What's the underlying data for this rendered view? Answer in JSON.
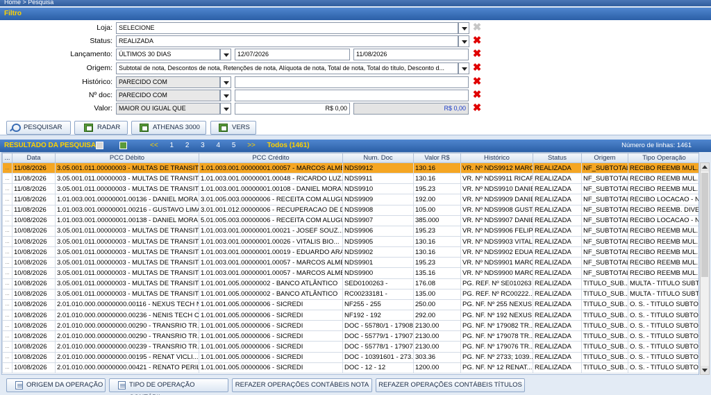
{
  "breadcrumb": "Home > Pesquisa",
  "filter": {
    "title": "Filtro",
    "loja_label": "Loja:",
    "loja_value": "SELECIONE",
    "status_label": "Status:",
    "status_value": "REALIZADA",
    "lancamento_label": "Lançamento:",
    "lancamento_value": "ÚLTIMOS 30 DIAS",
    "lancamento_from": "12/07/2026",
    "lancamento_to": "11/08/2026",
    "origem_label": "Origem:",
    "origem_value": "Subtotal de nota, Descontos de nota, Retenções de nota, Alíquota de nota, Total de nota, Total do título, Desconto d...",
    "historico_label": "Histórico:",
    "historico_value": "PARECIDO COM",
    "historico_text": "",
    "ndoc_label": "Nº doc:",
    "ndoc_value": "PARECIDO COM",
    "ndoc_text": "",
    "valor_label": "Valor:",
    "valor_value": "MAIOR  OU IGUAL QUE",
    "valor_from": "R$ 0,00",
    "valor_to": "R$ 0,00"
  },
  "toolbar": {
    "pesquisar": "PESQUISAR",
    "radar": "RADAR",
    "athenas": "ATHENAS 3000",
    "vers": "VERS"
  },
  "results": {
    "title": "RESULTADO DA PESQUISA",
    "prev": "<<",
    "pages": [
      "1",
      "2",
      "3",
      "4",
      "5"
    ],
    "next": ">>",
    "todos": "Todos (1461)",
    "line_count": "Número de linhas: 1461",
    "columns": [
      "...",
      "Data",
      "PCC Débito",
      "PCC Crédito",
      "Num. Doc",
      "Valor R$",
      "Histórico",
      "Status",
      "Origem",
      "Tipo Operação"
    ],
    "rows": [
      [
        "...",
        "11/08/2026",
        "3.05.001.011.00000003 - MULTAS DE TRANSITO",
        "1.01.003.001.00000001.00057 - MARCOS ALME...",
        "NDS9912",
        "130.16",
        "VR. Nº NDS9912 MARC...",
        "REALIZADA",
        "NF_SUBTOTAL",
        "RECIBO  REEMB MUL..."
      ],
      [
        "...",
        "11/08/2026",
        "3.05.001.011.00000003 - MULTAS DE TRANSITO",
        "1.01.003.001.00000001.00048 - RICARDO LUZ...",
        "NDS9911",
        "130.16",
        "VR. Nº NDS9911 RICAR...",
        "REALIZADA",
        "NF_SUBTOTAL",
        "RECIBO  REEMB MUL..."
      ],
      [
        "...",
        "11/08/2026",
        "3.05.001.011.00000003 - MULTAS DE TRANSITO",
        "1.01.003.001.00000001.00108 - DANIEL MORA...",
        "NDS9910",
        "195.23",
        "VR. Nº NDS9910 DANIE...",
        "REALIZADA",
        "NF_SUBTOTAL",
        "RECIBO  REEMB MUL..."
      ],
      [
        "...",
        "11/08/2026",
        "1.01.003.001.00000001.00136 - DANIEL MORA...",
        "3.01.005.003.00000006 - RECEITA COM ALUGU...",
        "NDS9909",
        "192.00",
        "VR. Nº NDS9909 DANIE...",
        "REALIZADA",
        "NF_SUBTOTAL",
        "RECIBO LOCACAO - N..."
      ],
      [
        "...",
        "11/08/2026",
        "1.01.003.001.00000001.00216 - GUSTAVO LIMA...",
        "3.01.001.012.00000006 - RECUPERACAO DE DE...",
        "NDS9908",
        "105.00",
        "VR. Nº NDS9908 GUSTA...",
        "REALIZADA",
        "NF_SUBTOTAL",
        "RECIBO  REEMB. DIVE..."
      ],
      [
        "...",
        "10/08/2026",
        "1.01.003.001.00000001.00138 - DANIEL MORA...",
        "5.01.005.003.00000006 - RECEITA COM ALUGU...",
        "NDS9907",
        "385.000",
        "VR. Nº NDS9907 DANIE...",
        "REALIZADA",
        "NF_SUBTOTAL",
        "RECIBO LOCACAO - N..."
      ],
      [
        "...",
        "10/08/2026",
        "3.05.001.011.00000003 - MULTAS DE TRANSITO",
        "1.01.003.001.00000001.00021 - JOSEF SOUZ...",
        "NDS9906",
        "195.23",
        "VR. Nº NDS9906 FELIP...",
        "REALIZADA",
        "NF_SUBTOTAL",
        "RECIBO  REEMB MUL..."
      ],
      [
        "...",
        "10/08/2026",
        "3.05.001.011.00000003 - MULTAS DE TRANSITO",
        "1.01.003.001.00000001.00026 - VITALIS BIO...",
        "NDS9905",
        "130.16",
        "VR. Nº NDS9903 VITAL...",
        "REALIZADA",
        "NF_SUBTOTAL",
        "RECIBO  REEMB MUL..."
      ],
      [
        "...",
        "10/08/2026",
        "3.05.001.011.00000003 - MULTAS DE TRANSITO",
        "1.01.003.001.00000001.00019 - EDUARDO ARA...",
        "NDS9902",
        "130.16",
        "VR. Nº NDS9902 EDUA...",
        "REALIZADA",
        "NF_SUBTOTAL",
        "RECIBO  REEMB MUL..."
      ],
      [
        "...",
        "10/08/2026",
        "3.05.001.011.00000003 - MULTAS DE TRANSITO",
        "1.01.003.001.00000001.00057 - MARCOS ALME...",
        "NDS9901",
        "195.23",
        "VR. Nº NDS9901 MARC...",
        "REALIZADA",
        "NF_SUBTOTAL",
        "RECIBO  REEMB MUL..."
      ],
      [
        "...",
        "10/08/2026",
        "3.05.001.011.00000003 - MULTAS DE TRANSITO",
        "1.01.003.001.00000001.00057 - MARCOS ALME...",
        "NDS9900",
        "135.16",
        "VR. Nº NDS9900 MARC...",
        "REALIZADA",
        "NF_SUBTOTAL",
        "RECIBO  REEMB MUL..."
      ],
      [
        "...",
        "10/08/2026",
        "3.05.001.011.00000003 - MULTAS DE TRANSITO",
        "1.01.001.005.00000002 - BANCO ATLÂNTICO",
        "SED0100263 -",
        "176.08",
        "PG. REF. Nº SE010263 -...",
        "REALIZADA",
        "TITULO_SUB...",
        "MULTA - TITULO SUBT..."
      ],
      [
        "...",
        "10/08/2026",
        "3.05.001.011.00000003 - MULTAS DE TRANSITO",
        "1.01.001.005.00000002 - BANCO ATLÂNTICO",
        "RC00233181 -",
        "135.00",
        "PG. REF. Nº RC00222...",
        "REALIZADA",
        "TITULO_SUB...",
        "MULTA - TITULO SUBT..."
      ],
      [
        "...",
        "10/08/2026",
        "2.01.010.000.00000000.00116 - NEXUS TECH NN...",
        "1.01.001.005.00000006 - SICREDI",
        "NF255 - 255",
        "250.00",
        "PG. NF. Nº 255 NEXUS...",
        "REALIZADA",
        "TITULO_SUB...",
        "O. S. - TITULO SUBTO..."
      ],
      [
        "...",
        "10/08/2026",
        "2.01.010.000.00000000.00236 - NENIS TECH CRI...",
        "1.01.001.005.00000006 - SICREDI",
        "NF192 - 192",
        "292.00",
        "PG. NF. Nº 192 NEXUS...",
        "REALIZADA",
        "TITULO_SUB...",
        "O. S. - TITULO SUBTO..."
      ],
      [
        "...",
        "10/08/2026",
        "2.01.010.000.00000000.00290 - TRANSRIO TR...",
        "1.01.001.005.00000006 - SICREDI",
        "DOC - 55780/1 - 179082",
        "2130.00",
        "PG. NF. Nº 179082  TR...",
        "REALIZADA",
        "TITULO_SUB...",
        "O. S. - TITULO SUBTO..."
      ],
      [
        "...",
        "10/08/2026",
        "2.01.010.000.00000000.00290 - TRANSRIO TR...",
        "1.01.001.005.00000006 - SICREDI",
        "DOC - 55779/1 - 179078",
        "2130.00",
        "PG. NF. Nº 179078  TR...",
        "REALIZADA",
        "TITULO_SUB...",
        "O. S. - TITULO SUBTO..."
      ],
      [
        "...",
        "10/08/2026",
        "2.01.010.000.00000000.00239 - TRANSRIO TR...",
        "1.01.001.005.00000006 - SICREDI",
        "DOC - 55778/1 - 179076",
        "2130.00",
        "PG. NF. Nº 179076  TR...",
        "REALIZADA",
        "TITULO_SUB...",
        "O. S. - TITULO SUBTO..."
      ],
      [
        "...",
        "10/08/2026",
        "2.01.010.000.00000000.00195 - RENAT VICLI...",
        "1.01.001.005.00000006 - SICREDI",
        "DOC - 10391601 - 273...",
        "303.36",
        "PG. NF. Nº 2733; 1039...",
        "REALIZADA",
        "TITULO_SUB...",
        "O. S. - TITULO SUBTO..."
      ],
      [
        "...",
        "10/08/2026",
        "2.01.010.000.00000000.00421 - RENATO PERIL...",
        "1.01.001.005.00000006 - SICREDI",
        "DOC - 12 - 12",
        "1200.00",
        "PG. NF. Nº 12  RENAT...",
        "REALIZADA",
        "TITULO_SUB...",
        "O. S. - TITULO SUBTO..."
      ]
    ]
  },
  "bottom": {
    "origem": "ORIGEM DA OPERAÇÃO",
    "tipo": "TIPO DE OPERAÇÃO CONTÁBIL",
    "refazer_nota": "REFAZER OPERAÇÕES CONTÁBEIS NOTA",
    "refazer_titulos": "REFAZER OPERAÇÕES CONTÁBEIS TÍTULOS"
  },
  "colors": {
    "header_blue": "#2b5fa6",
    "title_yellow": "#ffd200",
    "selected_row": "#f5a623",
    "clear_red": "#e00000"
  }
}
